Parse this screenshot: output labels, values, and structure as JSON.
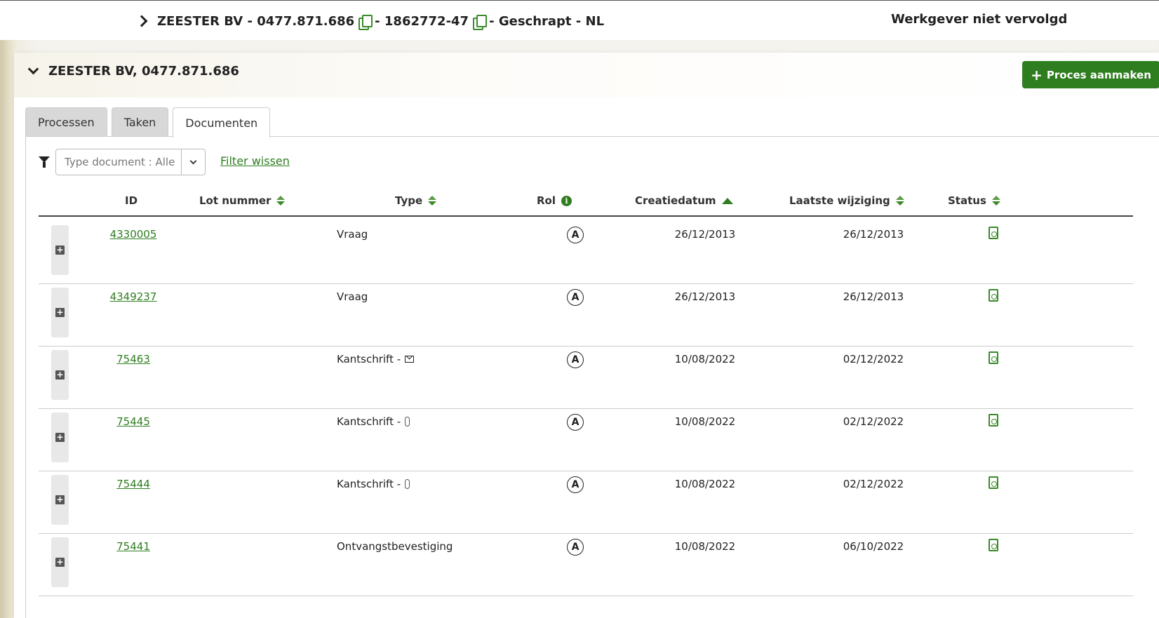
{
  "topbar": {
    "company": "ZEESTER BV - 0477.871.686",
    "separator1": "- 1862772-47",
    "suffix": "- Geschrapt - NL",
    "status": "Werkgever niet vervolgd"
  },
  "panel": {
    "title": "ZEESTER BV, 0477.871.686",
    "create_button": "Proces aanmaken"
  },
  "tabs": [
    {
      "label": "Processen",
      "active": false
    },
    {
      "label": "Taken",
      "active": false
    },
    {
      "label": "Documenten",
      "active": true
    }
  ],
  "filter": {
    "select_value": "Type document : Alle",
    "clear_label": "Filter wissen"
  },
  "columns": {
    "id": "ID",
    "lot": "Lot nummer",
    "type": "Type",
    "rol": "Rol",
    "created": "Creatiedatum",
    "modified": "Laatste wijziging",
    "status": "Status"
  },
  "rows": [
    {
      "id": "4330005",
      "type": "Vraag",
      "type_icon": "",
      "rol": "A",
      "created": "26/12/2013",
      "modified": "26/12/2013",
      "status_icon": "document-check-icon"
    },
    {
      "id": "4349237",
      "type": "Vraag",
      "type_icon": "",
      "rol": "A",
      "created": "26/12/2013",
      "modified": "26/12/2013",
      "status_icon": "document-check-icon"
    },
    {
      "id": "75463",
      "type": "Kantschrift -",
      "type_icon": "envelope-icon",
      "rol": "A",
      "created": "10/08/2022",
      "modified": "02/12/2022",
      "status_icon": "document-check-icon"
    },
    {
      "id": "75445",
      "type": "Kantschrift -",
      "type_icon": "paperclip-icon",
      "rol": "A",
      "created": "10/08/2022",
      "modified": "02/12/2022",
      "status_icon": "document-check-icon"
    },
    {
      "id": "75444",
      "type": "Kantschrift -",
      "type_icon": "paperclip-icon",
      "rol": "A",
      "created": "10/08/2022",
      "modified": "02/12/2022",
      "status_icon": "document-check-icon"
    },
    {
      "id": "75441",
      "type": "Ontvangstbevestiging",
      "type_icon": "",
      "rol": "A",
      "created": "10/08/2022",
      "modified": "06/10/2022",
      "status_icon": "document-check-icon"
    }
  ]
}
